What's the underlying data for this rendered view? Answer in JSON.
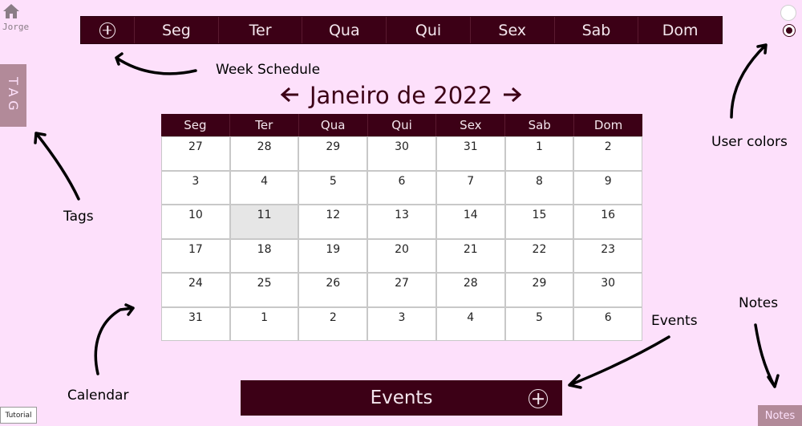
{
  "user": {
    "name": "Jorge"
  },
  "week_schedule": {
    "days": [
      "Seg",
      "Ter",
      "Qua",
      "Qui",
      "Sex",
      "Sab",
      "Dom"
    ]
  },
  "tags": {
    "label": "TAG"
  },
  "calendar": {
    "month_title": "Janeiro de 2022",
    "weekdays": [
      "Seg",
      "Ter",
      "Qua",
      "Qui",
      "Sex",
      "Sab",
      "Dom"
    ],
    "weeks": [
      [
        "27",
        "28",
        "29",
        "30",
        "31",
        "1",
        "2"
      ],
      [
        "3",
        "4",
        "5",
        "6",
        "7",
        "8",
        "9"
      ],
      [
        "10",
        "11",
        "12",
        "13",
        "14",
        "15",
        "16"
      ],
      [
        "17",
        "18",
        "19",
        "20",
        "21",
        "22",
        "23"
      ],
      [
        "24",
        "25",
        "26",
        "27",
        "28",
        "29",
        "30"
      ],
      [
        "31",
        "1",
        "2",
        "3",
        "4",
        "5",
        "6"
      ]
    ],
    "today": "11"
  },
  "events": {
    "label": "Events"
  },
  "buttons": {
    "tutorial": "Tutorial",
    "notes": "Notes"
  },
  "annotations": {
    "week_schedule": "Week Schedule",
    "user_colors": "User colors",
    "tags": "Tags",
    "calendar": "Calendar",
    "events": "Events",
    "notes": "Notes"
  },
  "colors": {
    "background": "#fde0fb",
    "primary": "#3c0016",
    "accent": "#b28a99"
  }
}
